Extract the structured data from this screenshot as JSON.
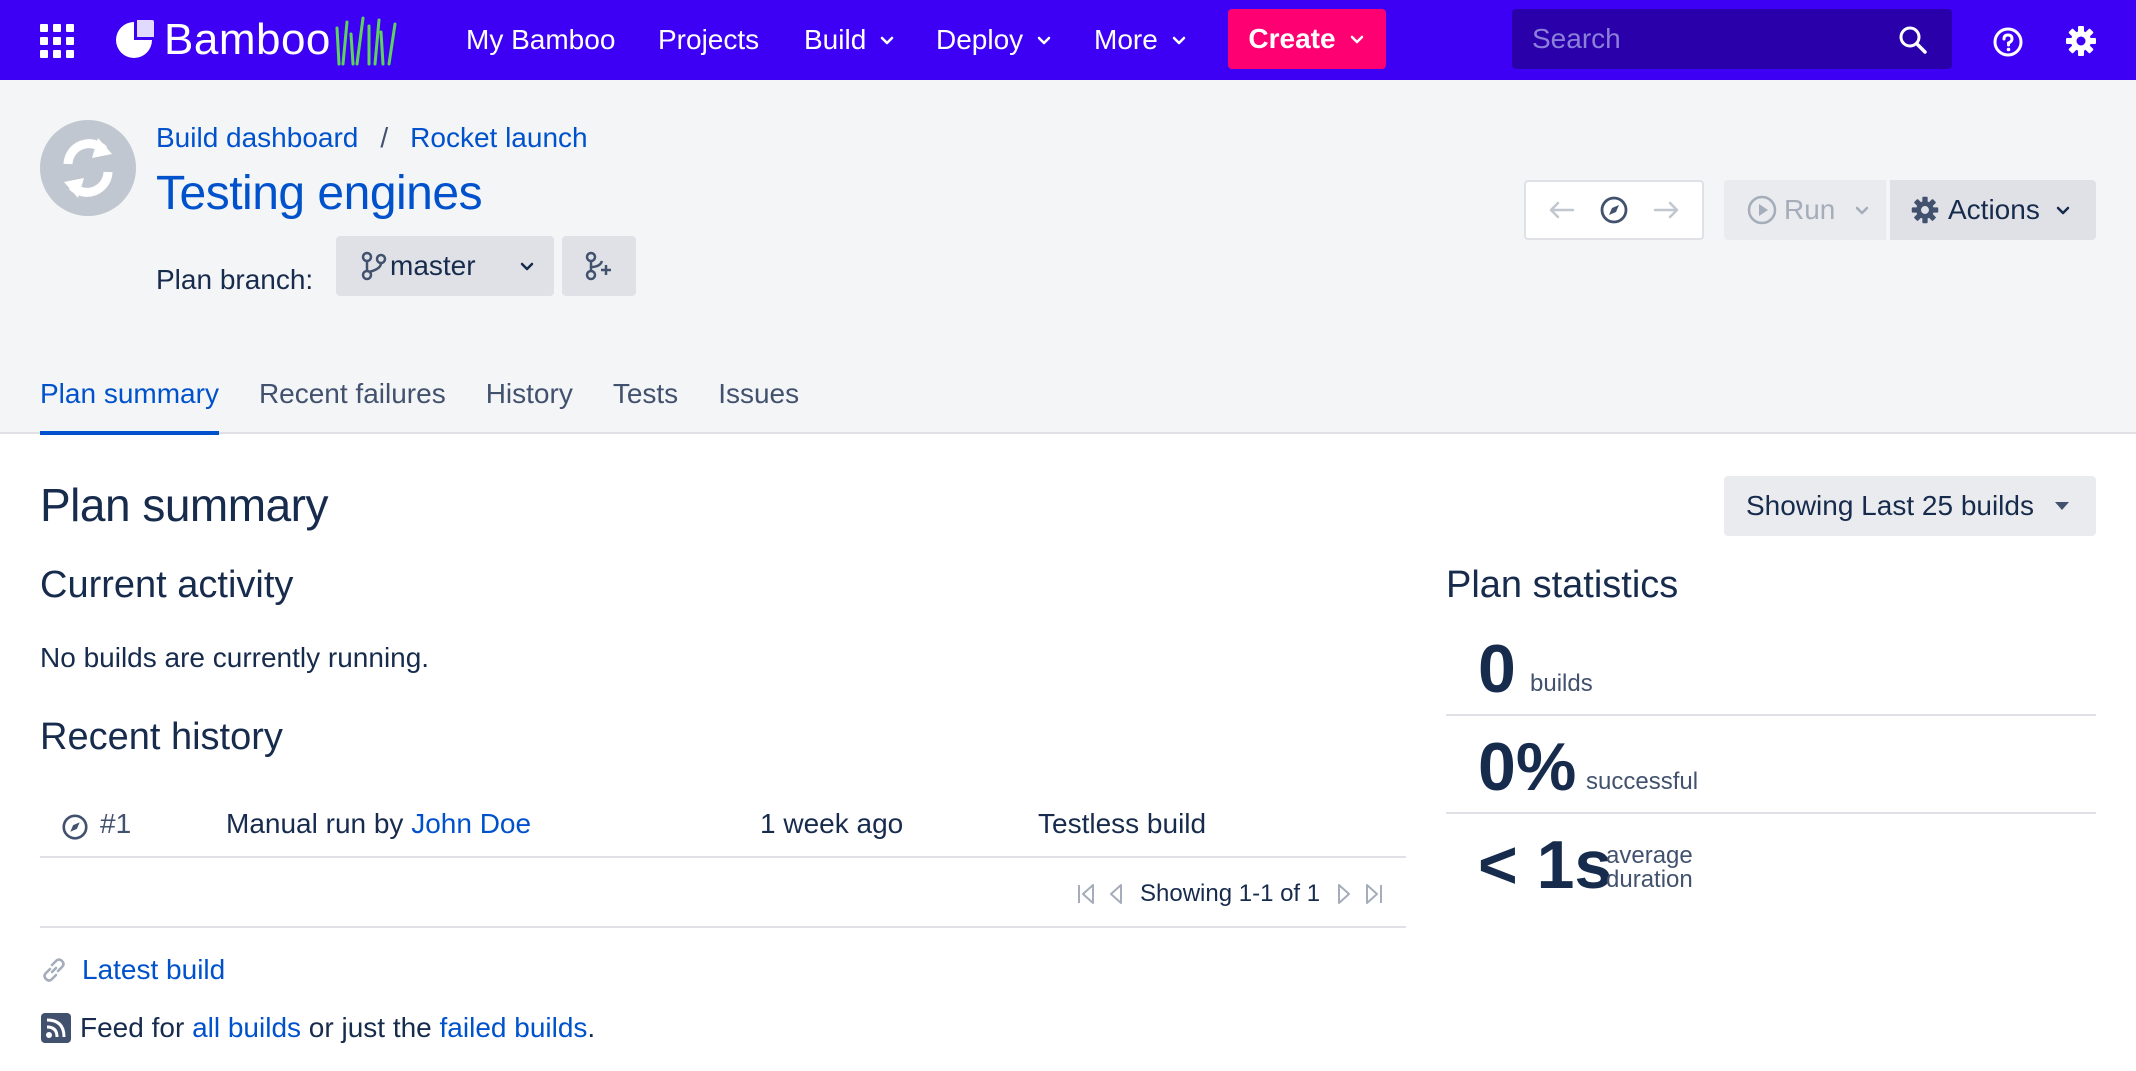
{
  "topnav": {
    "logo_text": "Bamboo",
    "items": [
      {
        "label": "My Bamboo"
      },
      {
        "label": "Projects"
      },
      {
        "label": "Build"
      },
      {
        "label": "Deploy"
      },
      {
        "label": "More"
      }
    ],
    "create_label": "Create",
    "search_placeholder": "Search",
    "bg_color": "#3D00F5",
    "create_color": "#FF0073"
  },
  "header": {
    "breadcrumb": [
      "Build dashboard",
      "Rocket launch"
    ],
    "breadcrumb_sep": "/",
    "title": "Testing engines",
    "branch_label": "Plan branch:",
    "branch_value": "master",
    "run_label": "Run",
    "actions_label": "Actions"
  },
  "tabs": [
    "Plan summary",
    "Recent failures",
    "History",
    "Tests",
    "Issues"
  ],
  "main": {
    "title": "Plan summary",
    "showing_label": "Showing Last 25 builds",
    "current_activity": {
      "heading": "Current activity",
      "text": "No builds are currently running."
    },
    "recent_history": {
      "heading": "Recent history",
      "rows": [
        {
          "number": "#1",
          "reason_prefix": "Manual run by",
          "user": "John Doe",
          "time": "1 week ago",
          "result": "Testless build"
        }
      ],
      "pager": "Showing 1-1 of 1"
    },
    "latest_build": "Latest build",
    "feed": {
      "prefix": "Feed for",
      "all_link": "all builds",
      "middle": "or just the",
      "failed_link": "failed builds",
      "suffix": "."
    }
  },
  "stats": {
    "heading": "Plan statistics",
    "builds_value": "0",
    "builds_label": "builds",
    "success_value": "0%",
    "success_label": "successful",
    "duration_value": "< 1s",
    "duration_label_1": "average",
    "duration_label_2": "duration"
  }
}
